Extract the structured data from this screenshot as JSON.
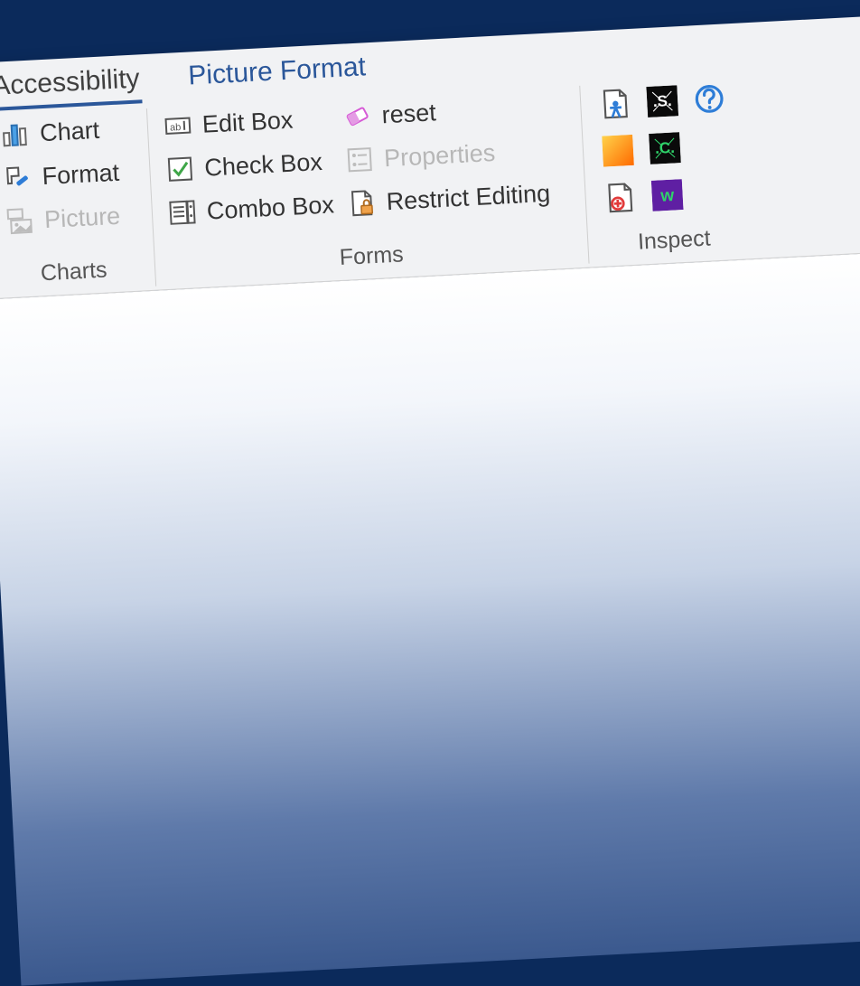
{
  "tabs": {
    "accessibility": "Accessibility",
    "picture_format": "Picture Format"
  },
  "groups": {
    "charts": {
      "label": "Charts",
      "chart": "Chart",
      "format": "Format",
      "picture": "Picture"
    },
    "forms": {
      "label": "Forms",
      "edit_box": "Edit Box",
      "check_box": "Check Box",
      "combo_box": "Combo Box",
      "reset": "reset",
      "properties": "Properties",
      "restrict_editing": "Restrict Editing"
    },
    "inspect": {
      "label": "Inspect"
    }
  }
}
